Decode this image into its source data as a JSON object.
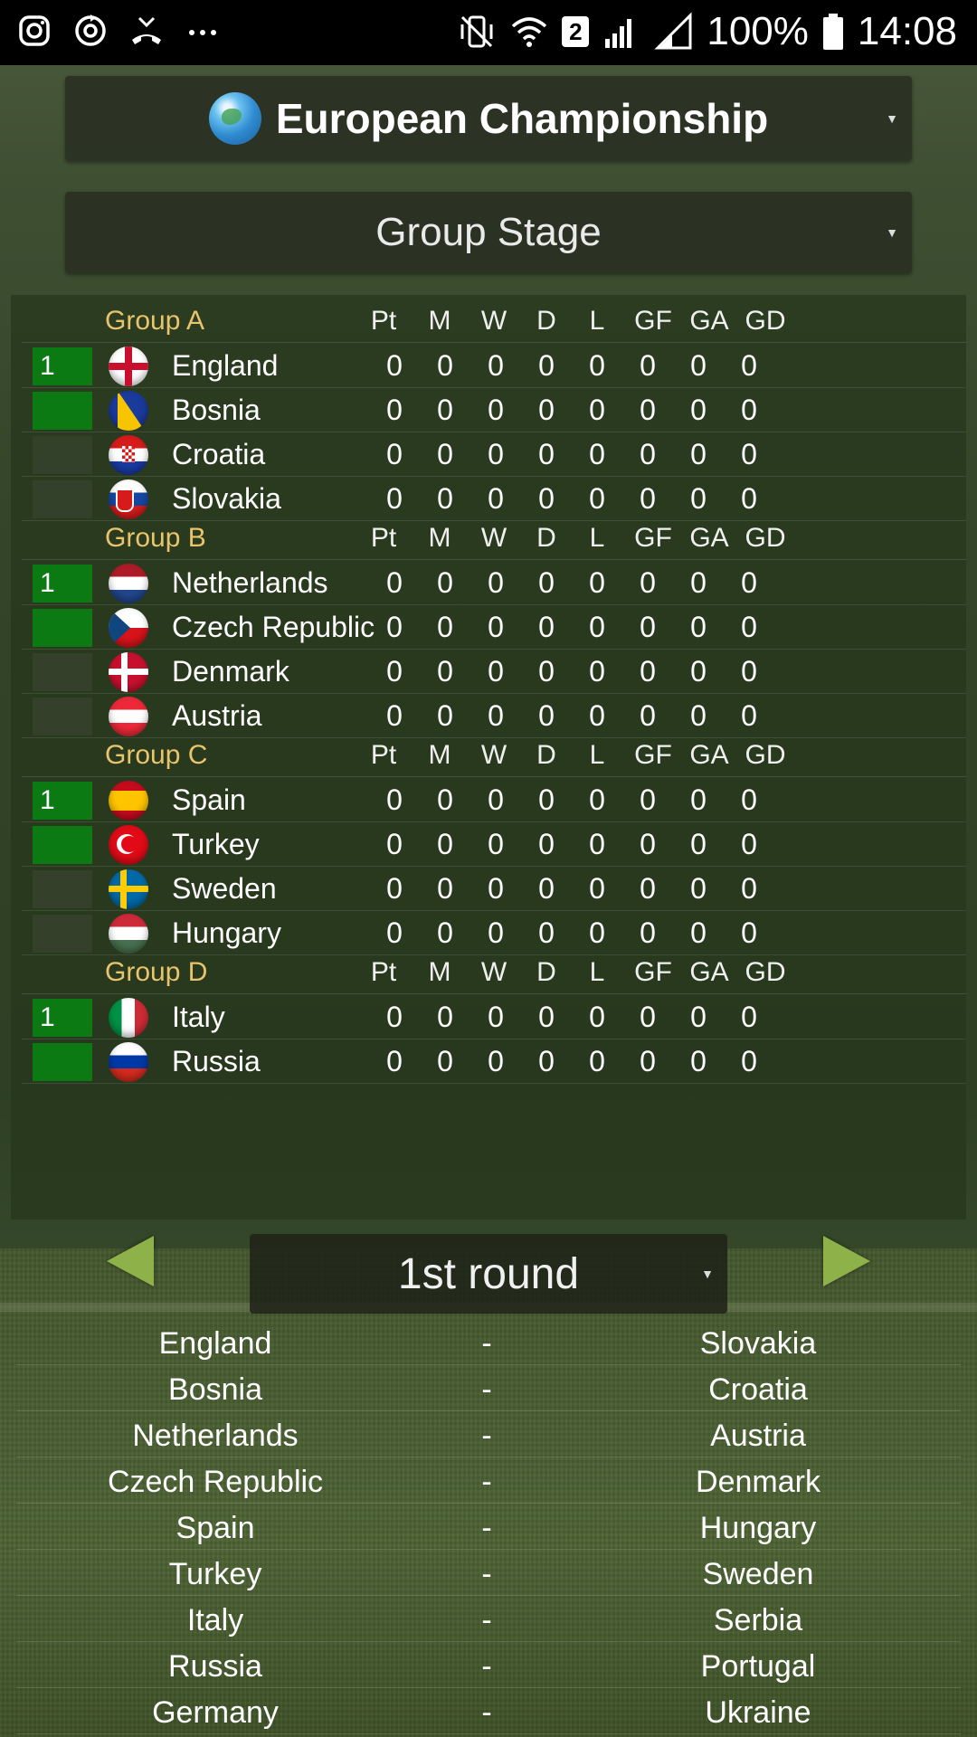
{
  "status_bar": {
    "left_icons": [
      "instagram-icon",
      "sync-icon",
      "missed-call-icon",
      "more-icon"
    ],
    "sim_badge": "2",
    "battery": "100%",
    "time": "14:08"
  },
  "competition": {
    "label": "European Championship",
    "icon": "globe-icon"
  },
  "stage": {
    "label": "Group Stage"
  },
  "columns": [
    "Pt",
    "M",
    "W",
    "D",
    "L",
    "GF",
    "GA",
    "GD"
  ],
  "groups": [
    {
      "name": "Group A",
      "teams": [
        {
          "rank": "1",
          "name": "England",
          "flag": "f-eng",
          "qualified": true,
          "stats": [
            "0",
            "0",
            "0",
            "0",
            "0",
            "0",
            "0",
            "0"
          ]
        },
        {
          "rank": "",
          "name": "Bosnia",
          "flag": "f-bih",
          "qualified": true,
          "stats": [
            "0",
            "0",
            "0",
            "0",
            "0",
            "0",
            "0",
            "0"
          ]
        },
        {
          "rank": "",
          "name": "Croatia",
          "flag": "f-cro",
          "qualified": false,
          "stats": [
            "0",
            "0",
            "0",
            "0",
            "0",
            "0",
            "0",
            "0"
          ]
        },
        {
          "rank": "",
          "name": "Slovakia",
          "flag": "f-svk",
          "qualified": false,
          "stats": [
            "0",
            "0",
            "0",
            "0",
            "0",
            "0",
            "0",
            "0"
          ]
        }
      ]
    },
    {
      "name": "Group B",
      "teams": [
        {
          "rank": "1",
          "name": "Netherlands",
          "flag": "f-ned",
          "qualified": true,
          "stats": [
            "0",
            "0",
            "0",
            "0",
            "0",
            "0",
            "0",
            "0"
          ]
        },
        {
          "rank": "",
          "name": "Czech Republic",
          "flag": "f-cze",
          "qualified": true,
          "stats": [
            "0",
            "0",
            "0",
            "0",
            "0",
            "0",
            "0",
            "0"
          ]
        },
        {
          "rank": "",
          "name": "Denmark",
          "flag": "f-den",
          "qualified": false,
          "stats": [
            "0",
            "0",
            "0",
            "0",
            "0",
            "0",
            "0",
            "0"
          ]
        },
        {
          "rank": "",
          "name": "Austria",
          "flag": "f-aut",
          "qualified": false,
          "stats": [
            "0",
            "0",
            "0",
            "0",
            "0",
            "0",
            "0",
            "0"
          ]
        }
      ]
    },
    {
      "name": "Group C",
      "teams": [
        {
          "rank": "1",
          "name": "Spain",
          "flag": "f-esp",
          "qualified": true,
          "stats": [
            "0",
            "0",
            "0",
            "0",
            "0",
            "0",
            "0",
            "0"
          ]
        },
        {
          "rank": "",
          "name": "Turkey",
          "flag": "f-tur",
          "qualified": true,
          "stats": [
            "0",
            "0",
            "0",
            "0",
            "0",
            "0",
            "0",
            "0"
          ]
        },
        {
          "rank": "",
          "name": "Sweden",
          "flag": "f-swe",
          "qualified": false,
          "stats": [
            "0",
            "0",
            "0",
            "0",
            "0",
            "0",
            "0",
            "0"
          ]
        },
        {
          "rank": "",
          "name": "Hungary",
          "flag": "f-hun",
          "qualified": false,
          "stats": [
            "0",
            "0",
            "0",
            "0",
            "0",
            "0",
            "0",
            "0"
          ]
        }
      ]
    },
    {
      "name": "Group D",
      "teams": [
        {
          "rank": "1",
          "name": "Italy",
          "flag": "f-ita",
          "qualified": true,
          "stats": [
            "0",
            "0",
            "0",
            "0",
            "0",
            "0",
            "0",
            "0"
          ]
        },
        {
          "rank": "",
          "name": "Russia",
          "flag": "f-rus",
          "qualified": true,
          "stats": [
            "0",
            "0",
            "0",
            "0",
            "0",
            "0",
            "0",
            "0"
          ]
        }
      ]
    }
  ],
  "round": {
    "label": "1st round"
  },
  "fixtures": [
    {
      "home": "England",
      "sep": "-",
      "away": "Slovakia"
    },
    {
      "home": "Bosnia",
      "sep": "-",
      "away": "Croatia"
    },
    {
      "home": "Netherlands",
      "sep": "-",
      "away": "Austria"
    },
    {
      "home": "Czech Republic",
      "sep": "-",
      "away": "Denmark"
    },
    {
      "home": "Spain",
      "sep": "-",
      "away": "Hungary"
    },
    {
      "home": "Turkey",
      "sep": "-",
      "away": "Sweden"
    },
    {
      "home": "Italy",
      "sep": "-",
      "away": "Serbia"
    },
    {
      "home": "Russia",
      "sep": "-",
      "away": "Portugal"
    },
    {
      "home": "Germany",
      "sep": "-",
      "away": "Ukraine"
    }
  ]
}
